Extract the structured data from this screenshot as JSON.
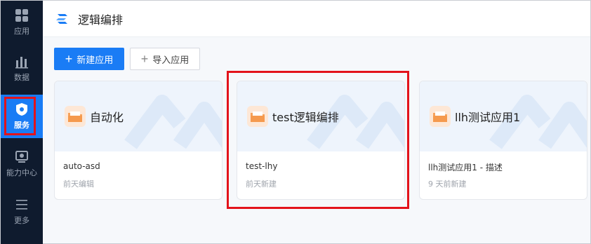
{
  "sidebar": {
    "items": [
      {
        "label": "应用",
        "icon": "grid-icon"
      },
      {
        "label": "数据",
        "icon": "bar-chart-icon"
      },
      {
        "label": "服务",
        "icon": "service-icon"
      },
      {
        "label": "能力中心",
        "icon": "monitor-icon"
      },
      {
        "label": "更多",
        "icon": "menu-icon"
      }
    ]
  },
  "header": {
    "title": "逻辑编排"
  },
  "toolbar": {
    "new_label": "新建应用",
    "import_label": "导入应用"
  },
  "cards": [
    {
      "name": "自动化",
      "description": "auto-asd",
      "meta": "前天编辑"
    },
    {
      "name": "test逻辑编排",
      "description": "test-lhy",
      "meta": "前天新建"
    },
    {
      "name": "llh测试应用1",
      "description": "llh测试应用1 - 描述",
      "meta": "9 天前新建"
    }
  ],
  "colors": {
    "accent": "#1a7cf5",
    "sidebar_bg": "#0f1b2e",
    "highlight": "#e3131b"
  }
}
